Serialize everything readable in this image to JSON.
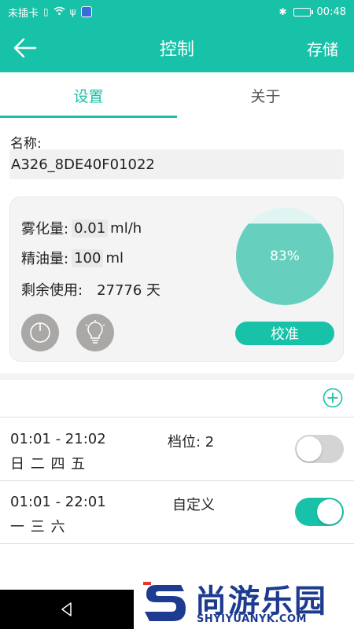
{
  "status_bar": {
    "carrier": "未插卡",
    "time": "00:48"
  },
  "toolbar": {
    "title": "控制",
    "save_label": "存储"
  },
  "tabs": [
    {
      "label": "设置",
      "active": true
    },
    {
      "label": "关于",
      "active": false
    }
  ],
  "name": {
    "label": "名称:",
    "value": "A326_8DE40F01022"
  },
  "device": {
    "atomization_label": "雾化量:",
    "atomization_value": "0.01",
    "atomization_unit": "ml/h",
    "oil_label": "精油量:",
    "oil_value": "100",
    "oil_unit": "ml",
    "remaining_label": "剩余使用:",
    "remaining_value": "27776 天",
    "level_text": "83%",
    "level_fraction": 0.83,
    "calibrate_label": "校准"
  },
  "schedules": [
    {
      "time": "01:01 - 21:02",
      "mode": "档位:  2",
      "days": "日 二 四 五",
      "enabled": false
    },
    {
      "time": "01:01 - 22:01",
      "mode": "自定义",
      "days": "一 三 六",
      "enabled": true
    }
  ],
  "watermark": {
    "title": "尚游乐园",
    "url": "SHYIYUANYK.COM"
  },
  "colors": {
    "accent": "#18c2a8",
    "gauge": "#66cfbe"
  }
}
